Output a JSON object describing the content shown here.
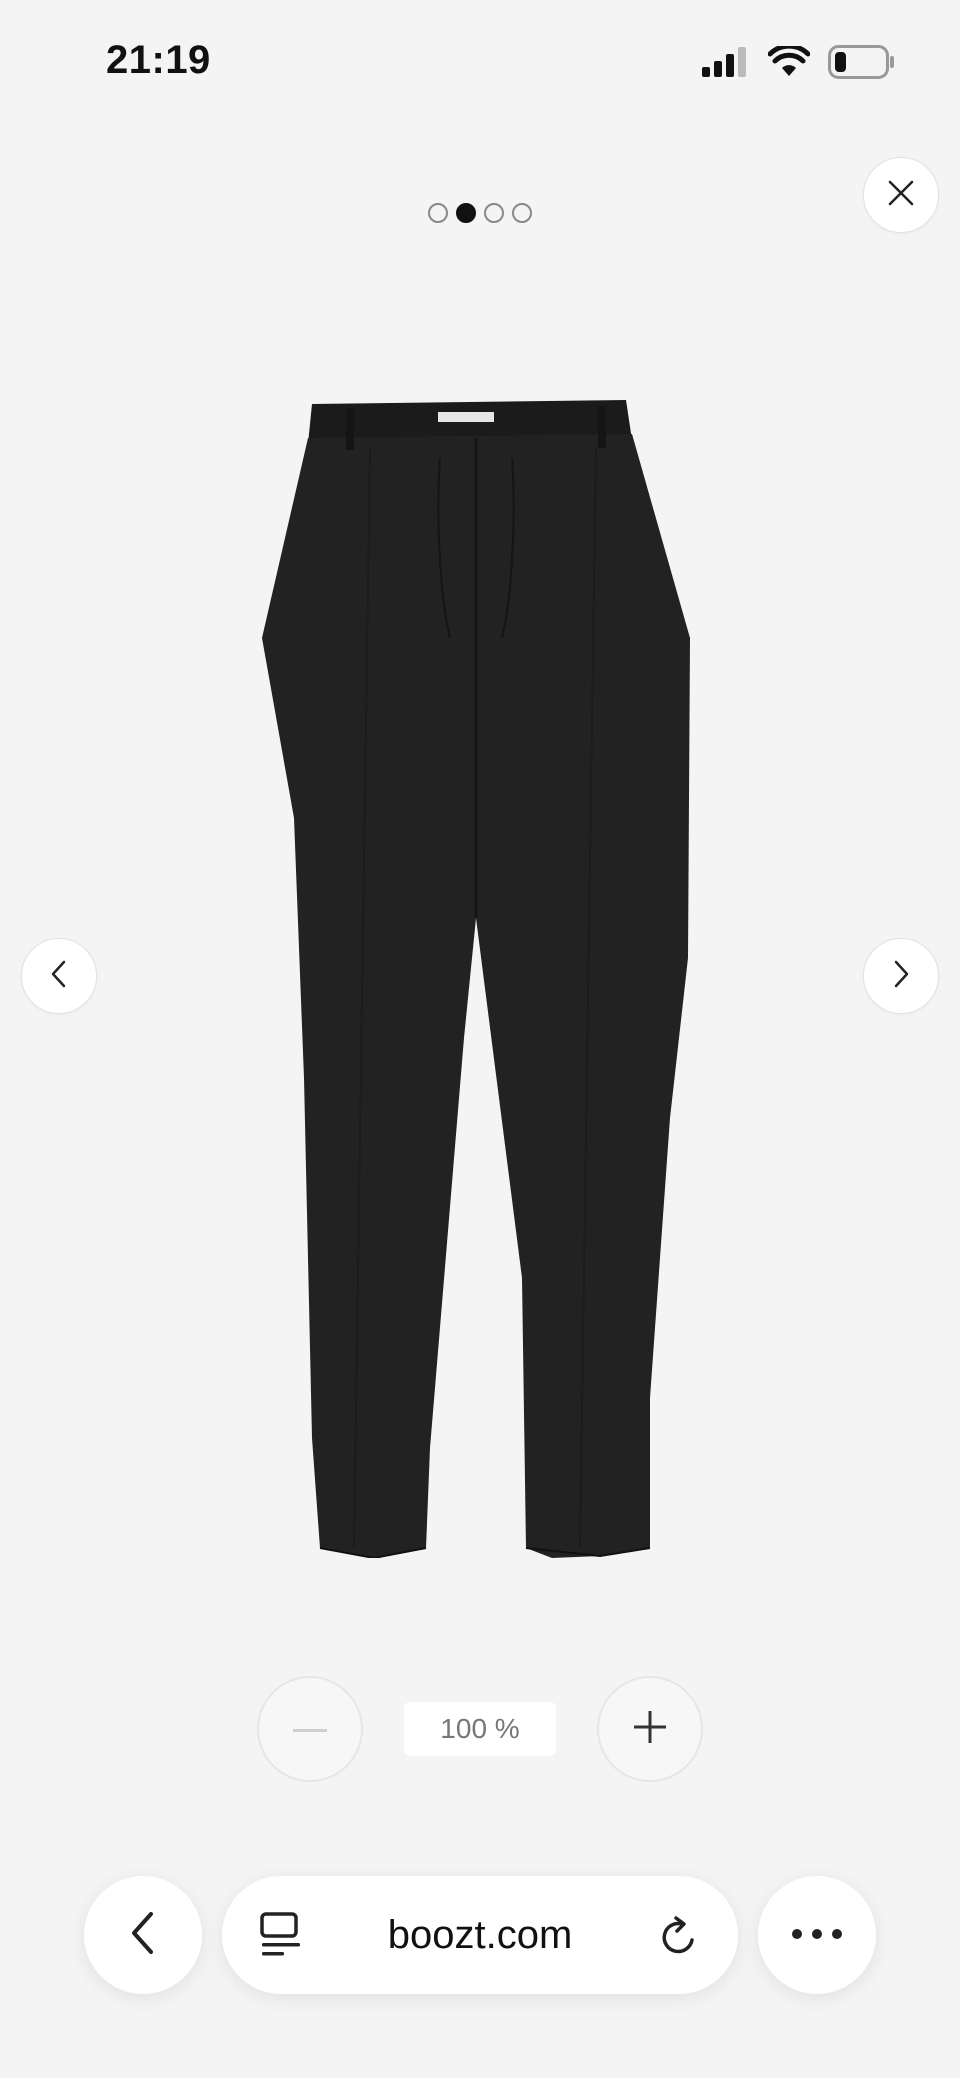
{
  "status_bar": {
    "time": "21:19",
    "icons": [
      "cellular-signal-icon",
      "wifi-icon",
      "battery-icon"
    ],
    "battery_level": 0.2
  },
  "gallery": {
    "page_count": 4,
    "active_index": 1,
    "close_icon": "close-icon",
    "prev_icon": "chevron-left-icon",
    "next_icon": "chevron-right-icon"
  },
  "zoom": {
    "level_label": "100 %",
    "zoom_out_icon": "minus-icon",
    "zoom_in_icon": "plus-icon"
  },
  "browser": {
    "url": "boozt.com",
    "back_icon": "chevron-left-icon",
    "tabs_icon": "tab-overview-icon",
    "reload_icon": "reload-icon",
    "more_icon": "more-icon"
  },
  "colors": {
    "background": "#f4f4f4",
    "product": "#232222",
    "accent": "#111111"
  }
}
